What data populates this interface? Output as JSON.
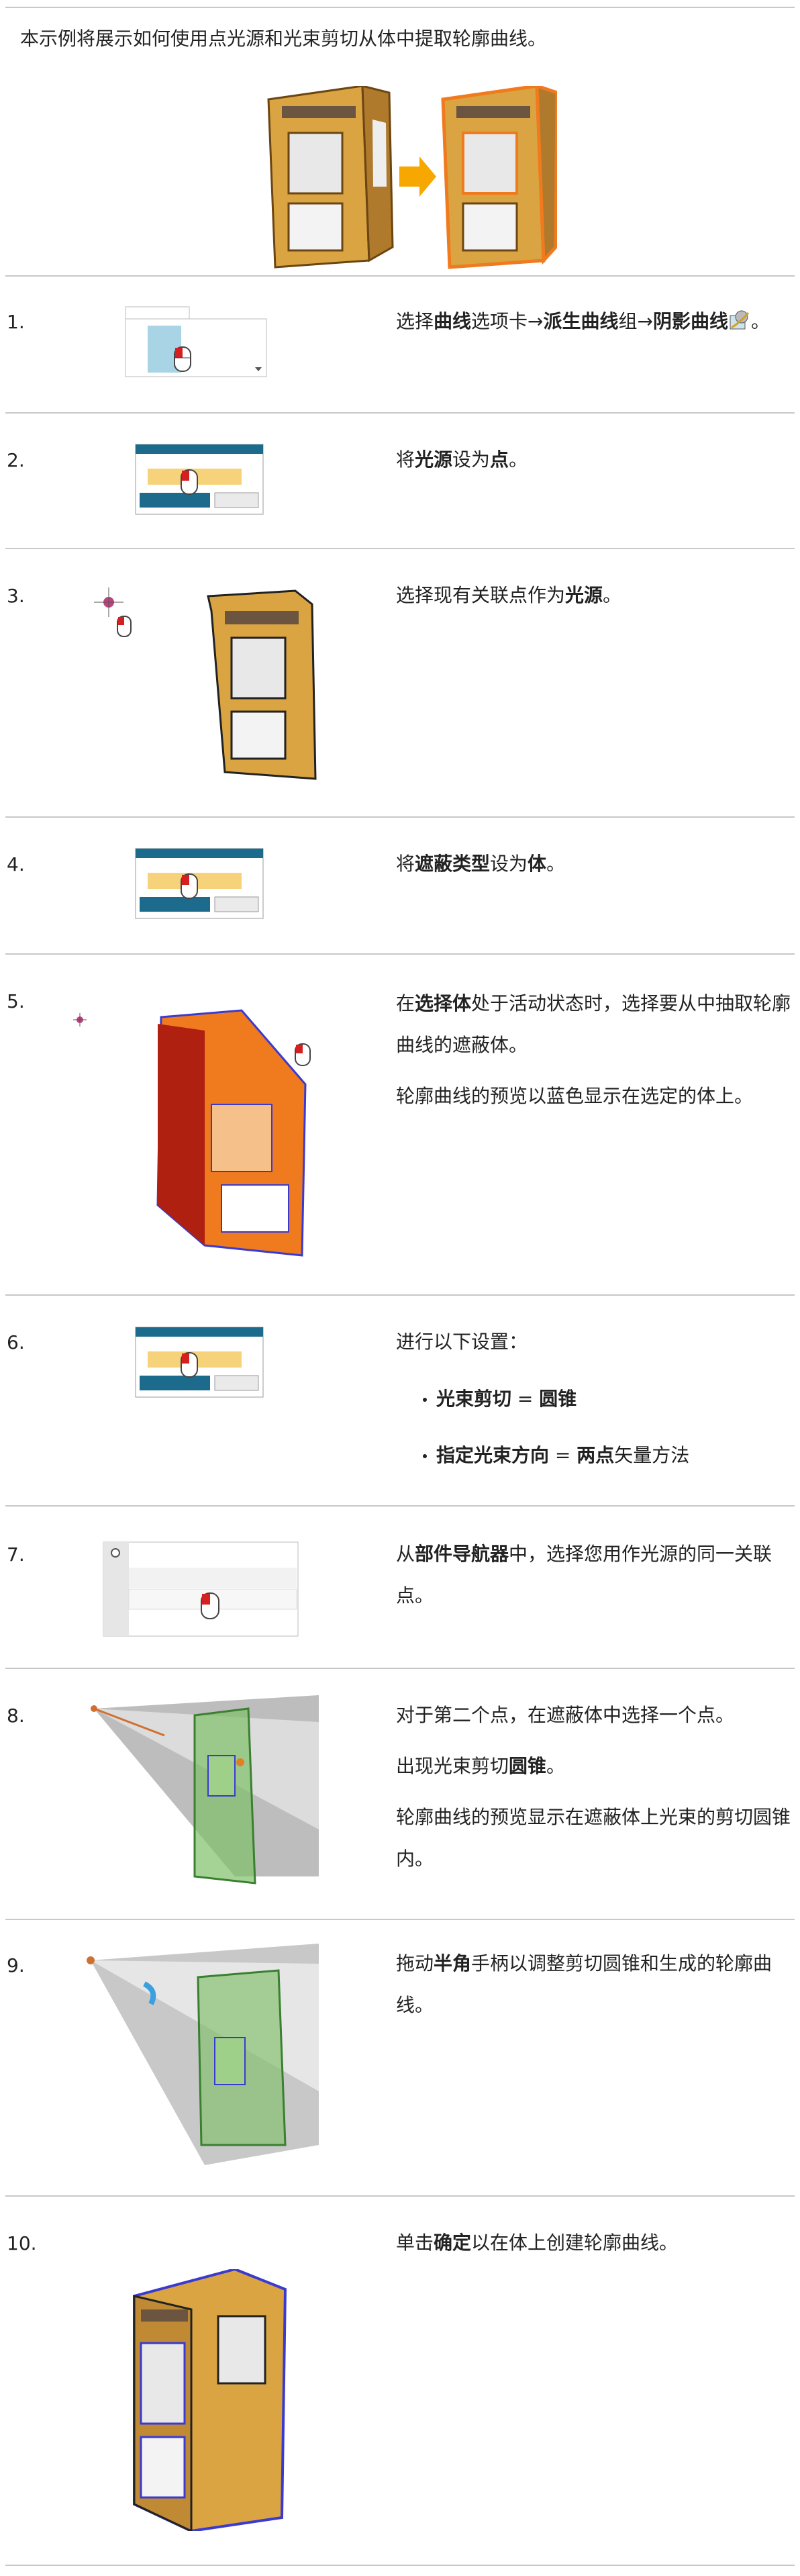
{
  "intro": "本示例将展示如何使用点光源和光束剪切从体中提取轮廓曲线。",
  "steps": [
    {
      "num": "1.",
      "t1": "选择",
      "b1": "曲线",
      "t2": "选项卡→",
      "b2": "派生曲线",
      "t3": "组→",
      "b3": "阴影曲线",
      "t4": "。"
    },
    {
      "num": "2.",
      "t1": "将",
      "b1": "光源",
      "t2": "设为",
      "b2": "点",
      "t3": "。"
    },
    {
      "num": "3.",
      "t1": "选择现有关联点作为",
      "b1": "光源",
      "t2": "。"
    },
    {
      "num": "4.",
      "t1": "将",
      "b1": "遮蔽类型",
      "t2": "设为",
      "b2": "体",
      "t3": "。"
    },
    {
      "num": "5.",
      "t1": "在",
      "b1": "选择体",
      "t2": "处于活动状态时，选择要从中抽取轮廓曲线的遮蔽体。",
      "p2": "轮廓曲线的预览以蓝色显示在选定的体上。"
    },
    {
      "num": "6.",
      "t1": "进行以下设置：",
      "li1_b": "光束剪切",
      "li1_t": " = ",
      "li1_b2": "圆锥",
      "li2_b": "指定光束方向",
      "li2_t": " = ",
      "li2_b2": "两点",
      "li2_t2": "矢量方法"
    },
    {
      "num": "7.",
      "t1": "从",
      "b1": "部件导航器",
      "t2": "中，选择您用作光源的同一关联点。"
    },
    {
      "num": "8.",
      "t1": "对于第二个点，在遮蔽体中选择一个点。",
      "p2a": "出现光束剪切",
      "p2b": "圆锥",
      "p2c": "。",
      "p3": "轮廓曲线的预览显示在遮蔽体上光束的剪切圆锥内。"
    },
    {
      "num": "9.",
      "t1": "拖动",
      "b1": "半角",
      "t2": "手柄以调整剪切圆锥和生成的轮廓曲线。"
    },
    {
      "num": "10.",
      "t1": "单击",
      "b1": "确定",
      "t2": "以在体上创建轮廓曲线。"
    }
  ],
  "colors": {
    "booth_tan": "#d9a441",
    "booth_dark": "#8a5a1a",
    "highlight_orange": "#f07a1e",
    "preview_green": "#7fc06a",
    "dialog_blue": "#1c6b8c",
    "field_yellow": "#f6d27a",
    "curve_blue": "#3a3ad0"
  },
  "icons": [
    "mouse-cursor-icon",
    "arrow-right-icon",
    "point-light-icon",
    "shadow-curve-icon"
  ]
}
